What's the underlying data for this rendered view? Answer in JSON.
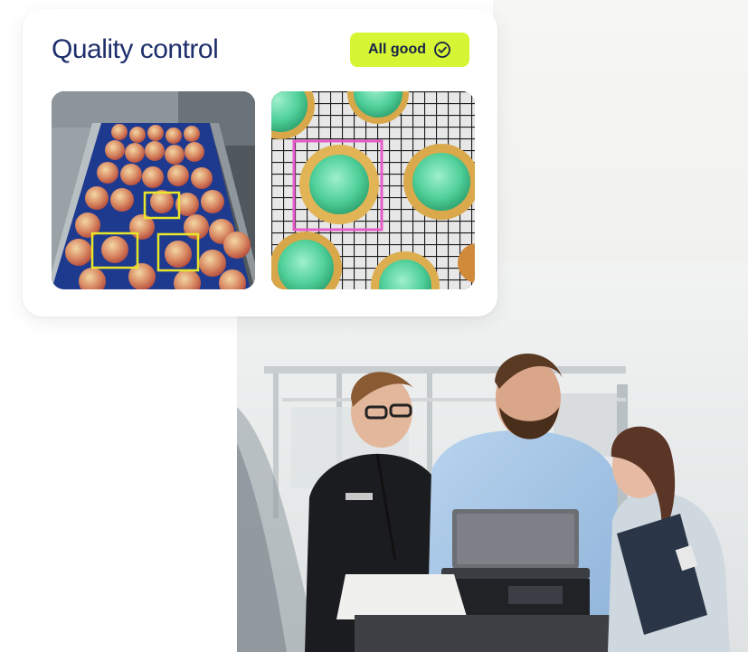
{
  "card": {
    "title": "Quality control",
    "status_label": "All good",
    "status_icon": "check-circle-icon",
    "accent_color": "#d6f534",
    "title_color": "#1e2f6b"
  },
  "images": [
    {
      "subject": "apples on conveyor belt",
      "detection_color": "#e8e62b"
    },
    {
      "subject": "cupcakes on cooling rack",
      "detection_color": "#e55ccb"
    }
  ],
  "photo": {
    "subject": "three colleagues reviewing a laptop in a factory"
  }
}
